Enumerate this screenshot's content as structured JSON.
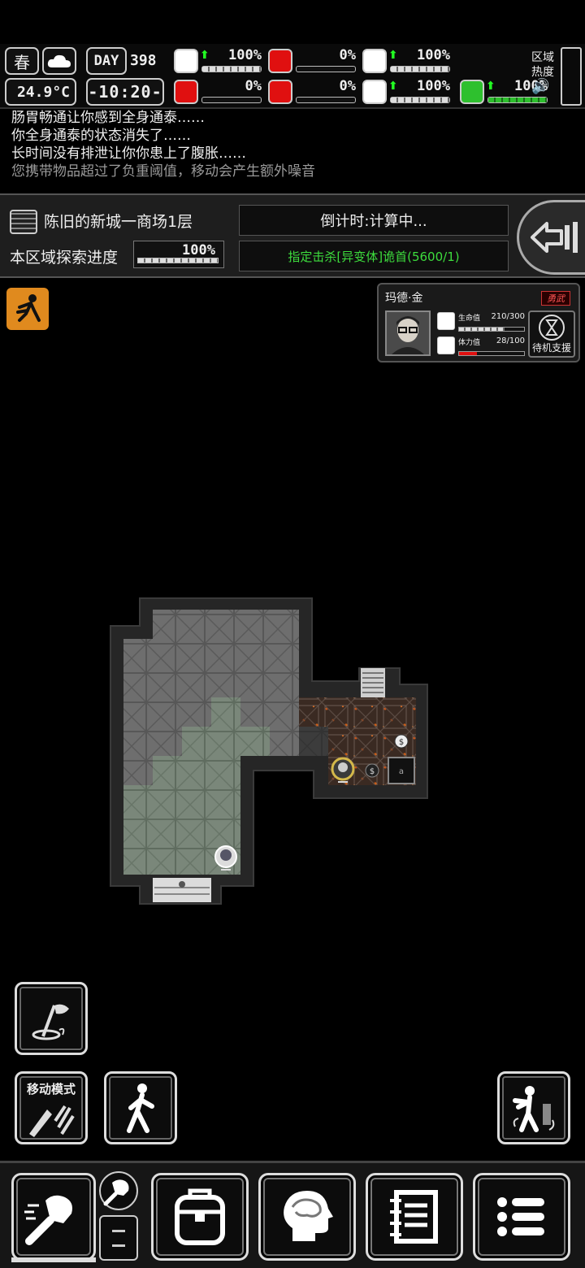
{
  "status": {
    "season": "春",
    "weather_icon": "cloud-icon",
    "temperature": "24.9°C",
    "day_label": "DAY",
    "day_value": "398",
    "clock": "-10:20-",
    "stats": [
      {
        "icon": "medkit-icon",
        "value": "100%",
        "up": true,
        "fill": 1.0,
        "color": "#ffffff"
      },
      {
        "icon": "stomach-icon",
        "value": "0%",
        "up": false,
        "fill": 0.0,
        "color": "#e01010"
      },
      {
        "icon": "pill-icon",
        "value": "100%",
        "up": true,
        "fill": 1.0,
        "color": "#ffffff"
      },
      {
        "icon": "brain-icon",
        "value": "0%",
        "up": false,
        "fill": 0.0,
        "color": "#e01010"
      },
      {
        "icon": "blood-drop-icon",
        "value": "0%",
        "up": false,
        "fill": 0.0,
        "color": "#e01010"
      },
      {
        "icon": "heart-icon",
        "value": "100%",
        "up": true,
        "fill": 1.0,
        "color": "#ffffff"
      },
      {
        "icon": "stamina-boot-icon",
        "value": "100%",
        "up": true,
        "fill": 1.0,
        "color": "#2ec02e"
      }
    ],
    "zone_heat_label": "区域热度"
  },
  "log": {
    "lines": [
      "肠胃畅通让你感到全身通泰……",
      "你全身通泰的状态消失了……",
      "长时间没有排泄让你你患上了腹胀……"
    ],
    "last_line": "您携带物品超过了负重阈值，移动会产生额外噪音"
  },
  "info": {
    "location": "陈旧的新城一商场1层",
    "explore_label": "本区域探索进度",
    "explore_value": "100%",
    "explore_fill": 1.0,
    "countdown": "倒计时:计算中...",
    "mission": "指定击杀[异变体]诡首(5600/1)"
  },
  "companion": {
    "name": "玛德·金",
    "tag": "勇武",
    "hp_label": "生命值",
    "hp_value": "210/300",
    "hp_fill": 0.7,
    "stamina_label": "体力值",
    "stamina_value": "28/100",
    "stamina_fill": 0.28,
    "standby_label": "待机支援"
  },
  "controls": {
    "move_mode_label": "移动模式"
  },
  "colors": {
    "accent_green": "#3ddc3d",
    "danger_red": "#e01010",
    "sneak_orange": "#e08a1e"
  }
}
